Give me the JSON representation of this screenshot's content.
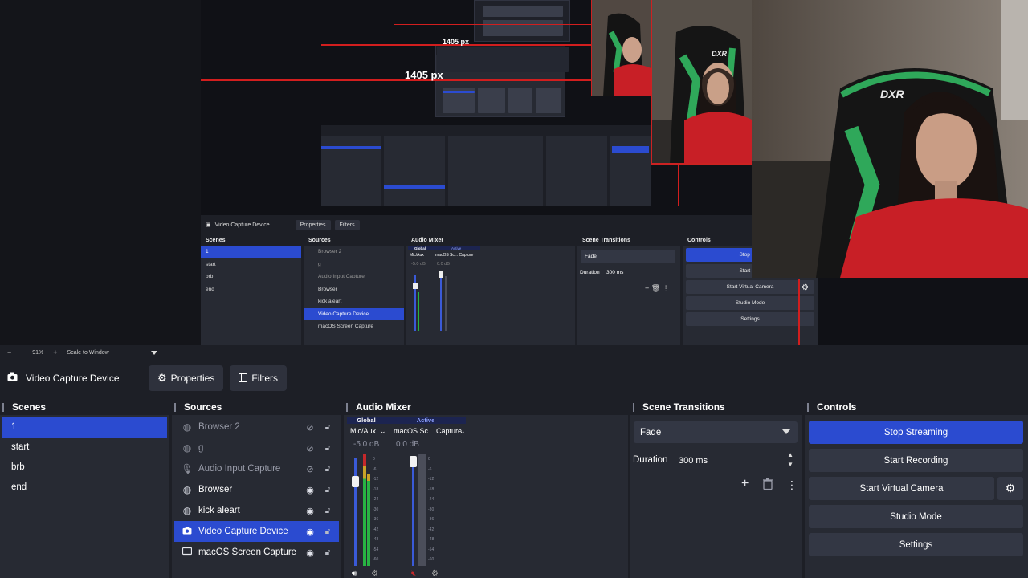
{
  "preview": {
    "measure_big": "1405 px",
    "measure_small": "1405 px",
    "status_zoom": "91%",
    "status_scale": "Scale to Window",
    "camera_brand": "DXR"
  },
  "mini_dock": {
    "source_title": "Video Capture Device",
    "properties": "Properties",
    "filters": "Filters",
    "scenes_header": "Scenes",
    "sources_header": "Sources",
    "mixer_header": "Audio Mixer",
    "transitions_header": "Scene Transitions",
    "controls_header": "Controls",
    "scenes": [
      "1",
      "start",
      "brb",
      "end"
    ],
    "sources": [
      "Browser 2",
      "g",
      "Audio Input Capture",
      "Browser",
      "kick aleart",
      "Video Capture Device",
      "macOS Screen Capture"
    ],
    "mixer_global": "Global",
    "mixer_active": "Active",
    "mixer_ch1": "Mic/Aux",
    "mixer_ch2": "macOS Sc... Capture",
    "mixer_db1": "-5.0 dB",
    "mixer_db2": "0.0 dB",
    "transition": "Fade",
    "duration_label": "Duration",
    "duration": "300 ms",
    "controls": [
      "Stop Stre",
      "Start Rec",
      "Start Virtual Camera",
      "Studio Mode",
      "Settings"
    ]
  },
  "statusbar": {
    "zoom_minus": "−",
    "zoom": "91%",
    "zoom_plus": "+",
    "scale": "Scale to Window"
  },
  "context": {
    "source_title": "Video Capture Device",
    "properties": "Properties",
    "filters": "Filters"
  },
  "scenes": {
    "header": "Scenes",
    "items": [
      "1",
      "start",
      "brb",
      "end"
    ]
  },
  "sources": {
    "header": "Sources",
    "items": [
      {
        "label": "Browser 2",
        "icon": "globe-icon",
        "hidden": true
      },
      {
        "label": "g",
        "icon": "globe-icon",
        "hidden": true
      },
      {
        "label": "Audio Input Capture",
        "icon": "microphone-icon",
        "hidden": true
      },
      {
        "label": "Browser",
        "icon": "globe-icon",
        "hidden": false
      },
      {
        "label": "kick aleart",
        "icon": "globe-icon",
        "hidden": false
      },
      {
        "label": "Video Capture Device",
        "icon": "camera-icon",
        "hidden": false
      },
      {
        "label": "macOS Screen Capture",
        "icon": "monitor-icon",
        "hidden": false
      }
    ]
  },
  "mixer": {
    "header": "Audio Mixer",
    "tab_global": "Global",
    "tab_active": "Active",
    "ch1_name": "Mic/Aux",
    "ch1_db": "-5.0 dB",
    "ch2_name": "macOS Sc... Capture",
    "ch2_db": "0.0 dB",
    "ticks": [
      "0",
      "-6",
      "-12",
      "-18",
      "-24",
      "-30",
      "-36",
      "-42",
      "-48",
      "-54",
      "-60"
    ]
  },
  "transitions": {
    "header": "Scene Transitions",
    "selected": "Fade",
    "duration_label": "Duration",
    "duration_value": "300 ms"
  },
  "controls": {
    "header": "Controls",
    "stop_streaming": "Stop Streaming",
    "start_recording": "Start Recording",
    "start_virtual_camera": "Start Virtual Camera",
    "studio_mode": "Studio Mode",
    "settings": "Settings"
  },
  "colors": {
    "accent": "#2b4bd0",
    "panel": "#272a33",
    "background": "#1d1f26",
    "measure_line": "#d21e1e"
  }
}
